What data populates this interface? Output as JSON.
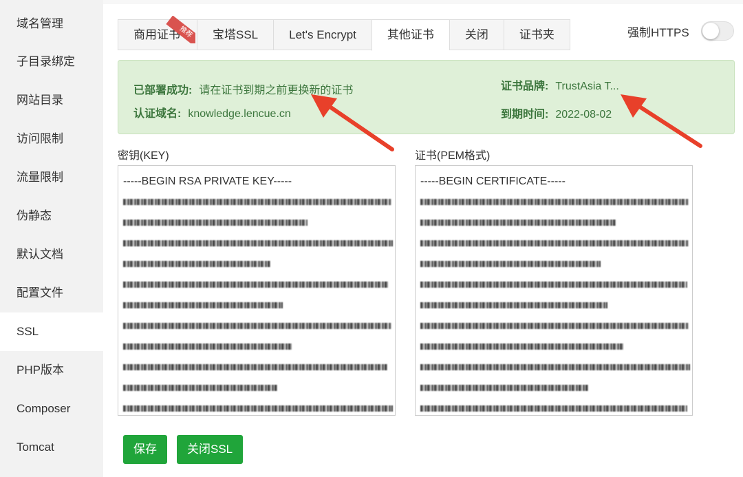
{
  "sidebar": {
    "items": [
      {
        "label": "域名管理"
      },
      {
        "label": "子目录绑定"
      },
      {
        "label": "网站目录"
      },
      {
        "label": "访问限制"
      },
      {
        "label": "流量限制"
      },
      {
        "label": "伪静态"
      },
      {
        "label": "默认文档"
      },
      {
        "label": "配置文件"
      },
      {
        "label": "SSL",
        "active": true
      },
      {
        "label": "PHP版本"
      },
      {
        "label": "Composer"
      },
      {
        "label": "Tomcat"
      }
    ]
  },
  "tabs": [
    {
      "label": "商用证书",
      "badge": "推荐"
    },
    {
      "label": "宝塔SSL"
    },
    {
      "label": "Let's Encrypt"
    },
    {
      "label": "其他证书",
      "active": true
    },
    {
      "label": "关闭"
    },
    {
      "label": "证书夹"
    }
  ],
  "force_https": {
    "label": "强制HTTPS",
    "enabled": false
  },
  "alert": {
    "deploy_label": "已部署成功:",
    "deploy_text": "请在证书到期之前更换新的证书",
    "domain_label": "认证域名:",
    "domain_value": "knowledge.lencue.cn",
    "brand_label": "证书品牌:",
    "brand_value": "TrustAsia T...",
    "expire_label": "到期时间:",
    "expire_value": "2022-08-02"
  },
  "key_field": {
    "label": "密钥(KEY)",
    "first_line": "-----BEGIN RSA PRIVATE KEY-----"
  },
  "cert_field": {
    "label": "证书(PEM格式)",
    "first_line": "-----BEGIN CERTIFICATE-----"
  },
  "buttons": {
    "save": "保存",
    "close_ssl": "关闭SSL"
  },
  "colors": {
    "primary": "#20a53a",
    "alert_bg": "#dff0d8",
    "alert_text": "#3c763d",
    "arrow": "#e8402a"
  }
}
